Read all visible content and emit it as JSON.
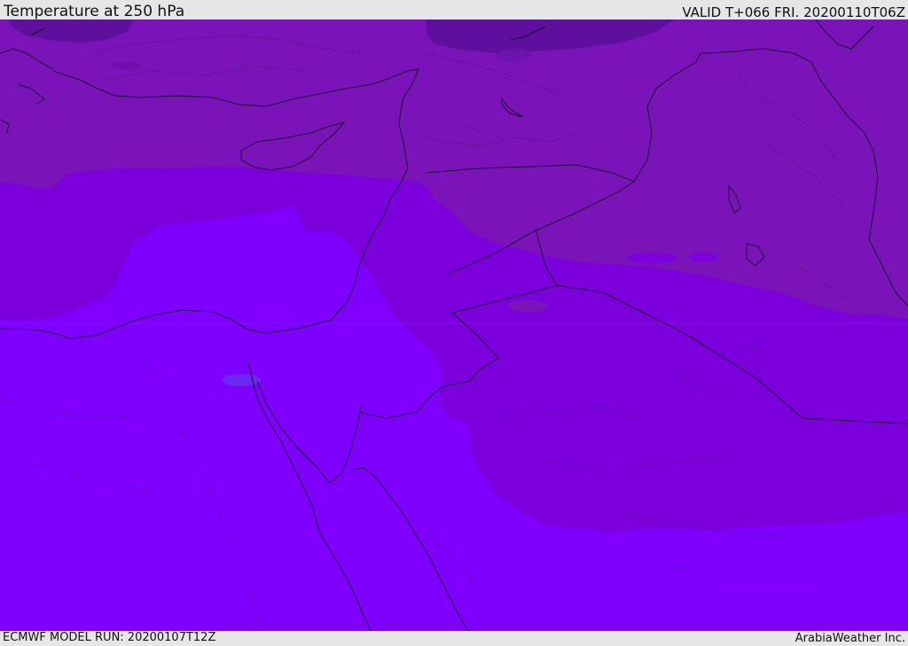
{
  "header": {
    "title": "Temperature at 250 hPa",
    "valid_time": "VALID T+066 FRI. 20200110T06Z"
  },
  "footer": {
    "model_run": "ECMWF MODEL RUN: 20200107T12Z",
    "credit": "ArabiaWeather Inc."
  },
  "map": {
    "field": "temperature",
    "level": "250 hPa",
    "colors": {
      "darkest_band": "#5e0f9e",
      "dark_band": "#7a14b8",
      "mid_band": "#7c00dc",
      "light_band": "#7f00ff",
      "patch": "#6a28f0",
      "boundary_line": "#1a1030"
    }
  }
}
